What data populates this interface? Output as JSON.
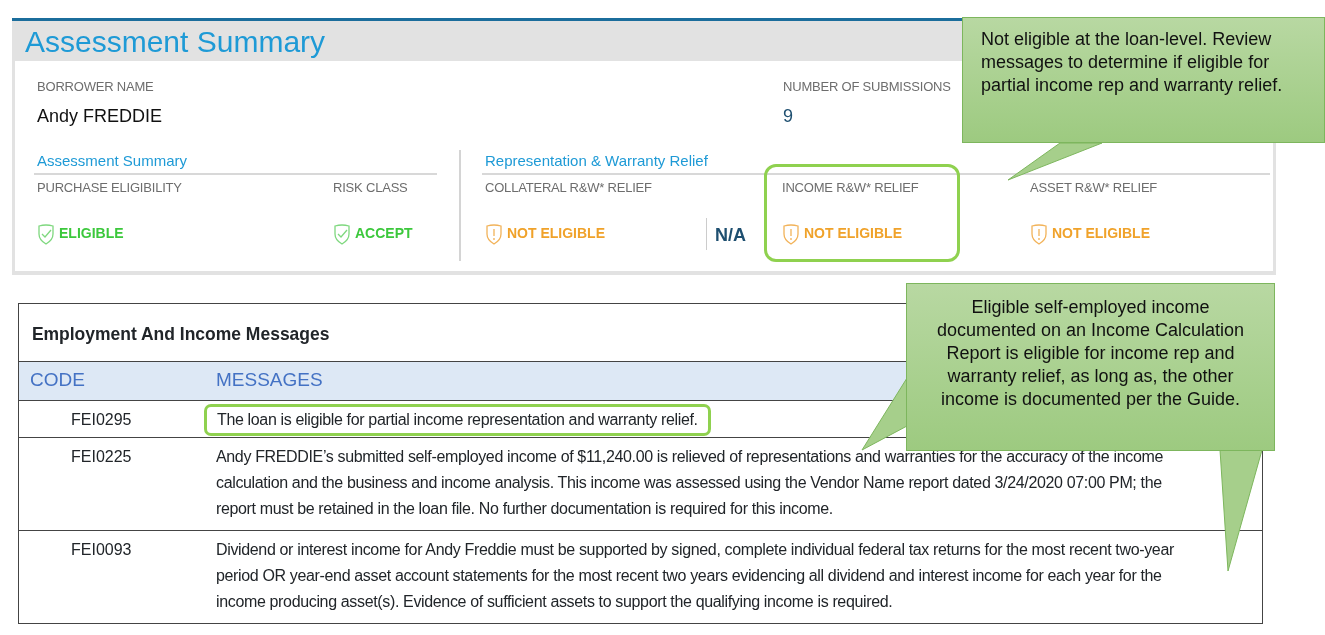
{
  "summary": {
    "title": "Assessment Summary",
    "fields": [
      {
        "label": "BORROWER NAME",
        "value": "Andy FREDDIE"
      },
      {
        "label": "NUMBER OF SUBMISSIONS",
        "value": "9"
      }
    ],
    "sections": [
      {
        "title": "Assessment Summary",
        "items": [
          {
            "label": "PURCHASE ELIGIBILITY",
            "status": "ELIGIBLE",
            "kind": "ok",
            "highlighted": false
          },
          {
            "label": "RISK CLASS",
            "status": "ACCEPT",
            "kind": "ok",
            "highlighted": false
          }
        ]
      },
      {
        "title": "Representation & Warranty Relief",
        "items": [
          {
            "label": "COLLATERAL R&W* RELIEF",
            "status": "NOT ELIGIBLE",
            "kind": "warn",
            "extra": "N/A",
            "highlighted": false
          },
          {
            "label": "INCOME R&W* RELIEF",
            "status": "NOT ELIGIBLE",
            "kind": "warn",
            "highlighted": true
          },
          {
            "label": "ASSET R&W* RELIEF",
            "status": "NOT ELIGIBLE",
            "kind": "warn",
            "highlighted": false
          }
        ]
      }
    ]
  },
  "messages": {
    "title": "Employment And Income Messages",
    "columns": [
      "CODE",
      "MESSAGES"
    ],
    "rows": [
      {
        "code": "FEI0295",
        "message": "The loan is eligible for partial income representation and warranty relief.",
        "highlighted": true
      },
      {
        "code": "FEI0225",
        "message": "Andy FREDDIE’s submitted self-employed income of $11,240.00 is relieved of representations and warranties for the accuracy of the income calculation and the business and income analysis. This income was assessed using the Vendor Name report dated 3/24/2020 07:00 PM; the report must be retained in the loan file. No further documentation is required for this income.",
        "highlighted": false
      },
      {
        "code": "FEI0093",
        "message": "Dividend or interest income for Andy Freddie must be supported by signed, complete individual federal tax returns for the most recent two-year period OR year-end asset account statements for the most recent two years evidencing all dividend and interest income for each year for the income producing asset(s). Evidence of sufficient assets to support the qualifying income is required.",
        "highlighted": false
      }
    ]
  },
  "callouts": [
    {
      "text": "Not eligible at the loan-level. Review messages to determine if eligible for partial income rep and warranty relief."
    },
    {
      "text": "Eligible self-employed income documented on an Income Calculation Report is eligible for income rep and warranty relief, as long as, the other income is documented per the Guide."
    }
  ]
}
